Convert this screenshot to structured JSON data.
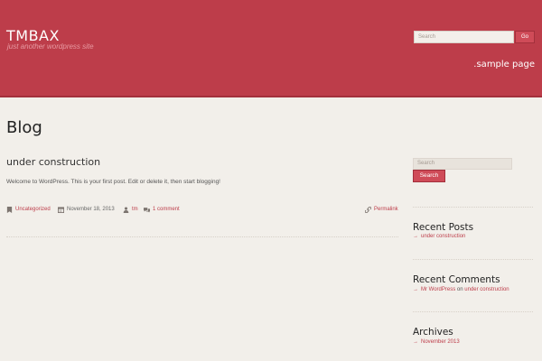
{
  "header": {
    "site_title": "TMBAX",
    "tagline": "just another wordpress site",
    "search_placeholder": "Search",
    "search_button": "Go",
    "nav_item": ".sample page"
  },
  "main": {
    "page_title": "Blog",
    "post": {
      "title": "under construction",
      "excerpt": "Welcome to WordPress. This is your first post. Edit or delete it, then start blogging!",
      "category": "Uncategorized",
      "date": "November 18, 2013",
      "author": "tm",
      "comments": "1 comment",
      "permalink": "Permalink"
    }
  },
  "sidebar": {
    "search_placeholder": "Search",
    "search_button": "Search",
    "recent_posts": {
      "title": "Recent Posts",
      "item": "under construction"
    },
    "recent_comments": {
      "title": "Recent Comments",
      "author": "Mr WordPress",
      "on": "on",
      "post": "under construction"
    },
    "archives": {
      "title": "Archives",
      "item": "November 2013"
    },
    "arrow": "→"
  },
  "colors": {
    "accent": "#bd3d4a",
    "background": "#f2efea"
  },
  "icons": [
    "tag-icon",
    "calendar-icon",
    "user-icon",
    "comment-icon",
    "link-icon"
  ]
}
